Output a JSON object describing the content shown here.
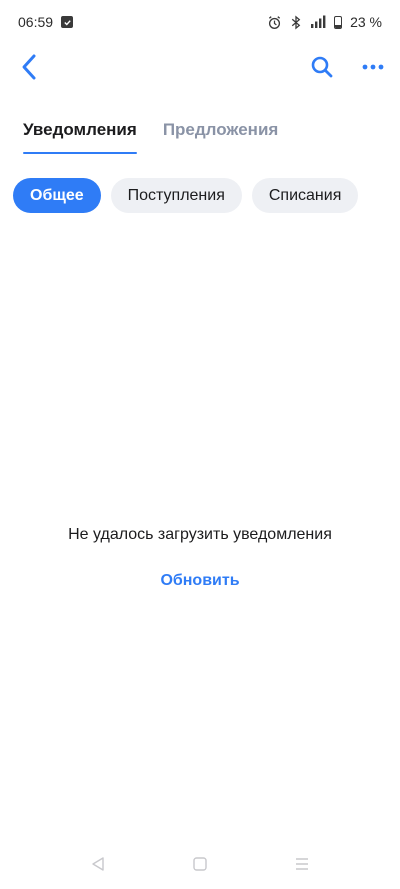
{
  "status_bar": {
    "time": "06:59",
    "battery_text": "23 %",
    "battery_level": 0.23,
    "icons": [
      "checkbox-notification-icon",
      "alarm-icon",
      "bluetooth-icon",
      "signal-icon",
      "battery-icon"
    ]
  },
  "toolbar": {
    "back_icon": "chevron-left-icon",
    "search_icon": "search-icon",
    "more_icon": "more-dots-icon",
    "accent_color": "#2f7cf6"
  },
  "tabs": [
    {
      "label": "Уведомления",
      "active": true
    },
    {
      "label": "Предложения",
      "active": false
    }
  ],
  "filters": [
    {
      "label": "Общее",
      "active": true
    },
    {
      "label": "Поступления",
      "active": false
    },
    {
      "label": "Списания",
      "active": false
    }
  ],
  "empty_state": {
    "message": "Не удалось загрузить уведомления",
    "action_label": "Обновить"
  },
  "navigation_bar": {
    "icons": [
      "back-triangle-icon",
      "home-square-icon",
      "menu-lines-icon"
    ]
  }
}
